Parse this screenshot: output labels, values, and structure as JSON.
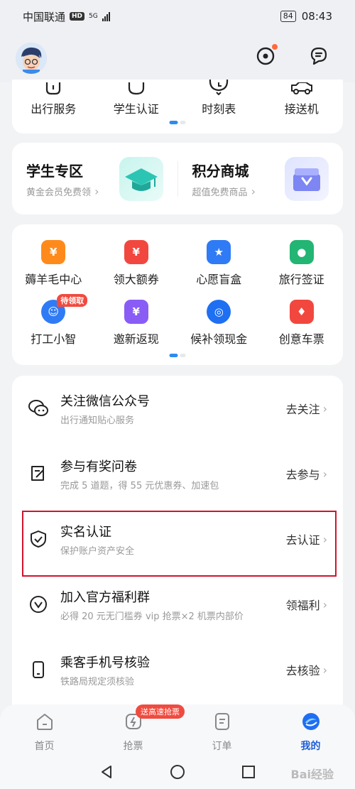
{
  "status_bar": {
    "carrier": "中国联通",
    "hd": "HD",
    "network": "5G",
    "battery": "84",
    "time": "08:43"
  },
  "top_services": [
    {
      "label": "出行服务",
      "icon": "bag-icon"
    },
    {
      "label": "学生认证",
      "icon": "graduation-icon"
    },
    {
      "label": "时刻表",
      "icon": "clock-icon"
    },
    {
      "label": "接送机",
      "icon": "car-icon"
    }
  ],
  "promos": [
    {
      "title": "学生专区",
      "subtitle": "黄金会员免费领",
      "icon": "graduation-cap-image"
    },
    {
      "title": "积分商城",
      "subtitle": "超值免费商品",
      "icon": "gift-box-image"
    }
  ],
  "benefits": [
    {
      "label": "薅羊毛中心",
      "icon": "yen-icon",
      "color": "#ff8a1c"
    },
    {
      "label": "领大额券",
      "icon": "coupon-icon",
      "color": "#f2473f"
    },
    {
      "label": "心愿盲盒",
      "icon": "box-icon",
      "color": "#2f7bf5"
    },
    {
      "label": "旅行签证",
      "icon": "passport-icon",
      "color": "#22b573"
    },
    {
      "label": "打工小智",
      "icon": "robot-icon",
      "color": "#2f7bf5",
      "tag": "待领取"
    },
    {
      "label": "邀新返现",
      "icon": "invite-icon",
      "color": "#8a5cf6"
    },
    {
      "label": "候补领现金",
      "icon": "train-icon",
      "color": "#1e6ff2"
    },
    {
      "label": "创意车票",
      "icon": "ticket-icon",
      "color": "#f2473f"
    }
  ],
  "list_items": [
    {
      "title": "关注微信公众号",
      "subtitle": "出行通知贴心服务",
      "action": "去关注",
      "icon": "wechat-icon"
    },
    {
      "title": "参与有奖问卷",
      "subtitle": "完成 5 道题，得 55 元优惠券、加速包",
      "action": "去参与",
      "icon": "survey-icon"
    },
    {
      "title": "实名认证",
      "subtitle": "保护账户资产安全",
      "action": "去认证",
      "icon": "shield-check-icon"
    },
    {
      "title": "加入官方福利群",
      "subtitle": "必得 20 元无门槛券 vip 抢票×2 机票内部价",
      "action": "领福利",
      "icon": "group-icon"
    },
    {
      "title": "乘客手机号核验",
      "subtitle": "铁路局规定须核验",
      "action": "去核验",
      "icon": "phone-icon"
    }
  ],
  "tabs": [
    {
      "label": "首页",
      "icon": "home-icon"
    },
    {
      "label": "抢票",
      "icon": "lightning-icon",
      "badge": "送高速抢票"
    },
    {
      "label": "订单",
      "icon": "order-icon"
    },
    {
      "label": "我的",
      "icon": "profile-icon",
      "active": true
    }
  ],
  "watermark": "Bai经验",
  "colors": {
    "accent": "#1e5fd8",
    "highlight_border": "#d0142c",
    "badge_red": "#f04b3f"
  }
}
